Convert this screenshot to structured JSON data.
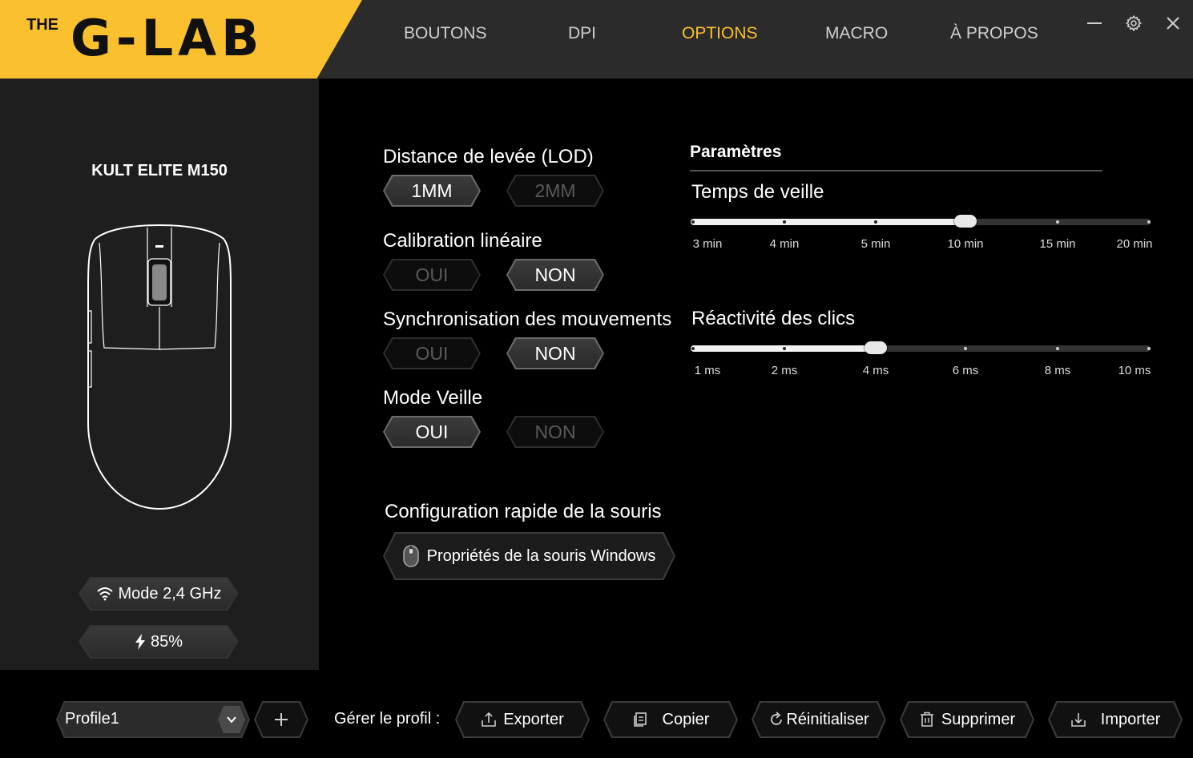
{
  "header": {
    "logo_small": "THE",
    "logo_main": "G-LAB",
    "tabs": [
      {
        "label": "BOUTONS",
        "active": false
      },
      {
        "label": "DPI",
        "active": false
      },
      {
        "label": "OPTIONS",
        "active": true
      },
      {
        "label": "MACRO",
        "active": false
      },
      {
        "label": "À PROPOS",
        "active": false
      }
    ],
    "window_controls": [
      "minimize-icon",
      "gear-icon",
      "close-icon"
    ]
  },
  "device": {
    "name": "KULT ELITE M150",
    "connection": "Mode 2,4 GHz",
    "battery": "85%"
  },
  "options": {
    "lod": {
      "label": "Distance de levée (LOD)",
      "choices": [
        "1MM",
        "2MM"
      ],
      "selected": "1MM"
    },
    "linear_calibration": {
      "label": "Calibration linéaire",
      "choices": [
        "OUI",
        "NON"
      ],
      "selected": "NON"
    },
    "motion_sync": {
      "label": "Synchronisation des mouvements",
      "choices": [
        "OUI",
        "NON"
      ],
      "selected": "NON"
    },
    "sleep_mode": {
      "label": "Mode Veille",
      "choices": [
        "OUI",
        "NON"
      ],
      "selected": "OUI"
    },
    "quick_config": {
      "label": "Configuration rapide de la souris",
      "button": "Propriétés de la souris Windows"
    }
  },
  "settings": {
    "title": "Paramètres",
    "sleep_time": {
      "label": "Temps de veille",
      "ticks": [
        "3 min",
        "4 min",
        "5 min",
        "10 min",
        "15 min",
        "20 min"
      ],
      "selected_index": 3
    },
    "click_response": {
      "label": "Réactivité des clics",
      "ticks": [
        "1 ms",
        "2 ms",
        "4 ms",
        "6 ms",
        "8 ms",
        "10 ms"
      ],
      "selected_index": 2
    }
  },
  "footer": {
    "profile": "Profile1",
    "add_label": "+",
    "manage_label": "Gérer le profil :",
    "actions": [
      {
        "label": "Exporter",
        "icon": "export-icon"
      },
      {
        "label": "Copier",
        "icon": "copy-icon"
      },
      {
        "label": "Réinitialiser",
        "icon": "reset-icon"
      },
      {
        "label": "Supprimer",
        "icon": "trash-icon"
      },
      {
        "label": "Importer",
        "icon": "import-icon"
      }
    ]
  },
  "colors": {
    "accent": "#fbc02d",
    "header_bg": "#2b2b2b",
    "panel_bg": "#1e1e1e",
    "background": "#000000"
  }
}
